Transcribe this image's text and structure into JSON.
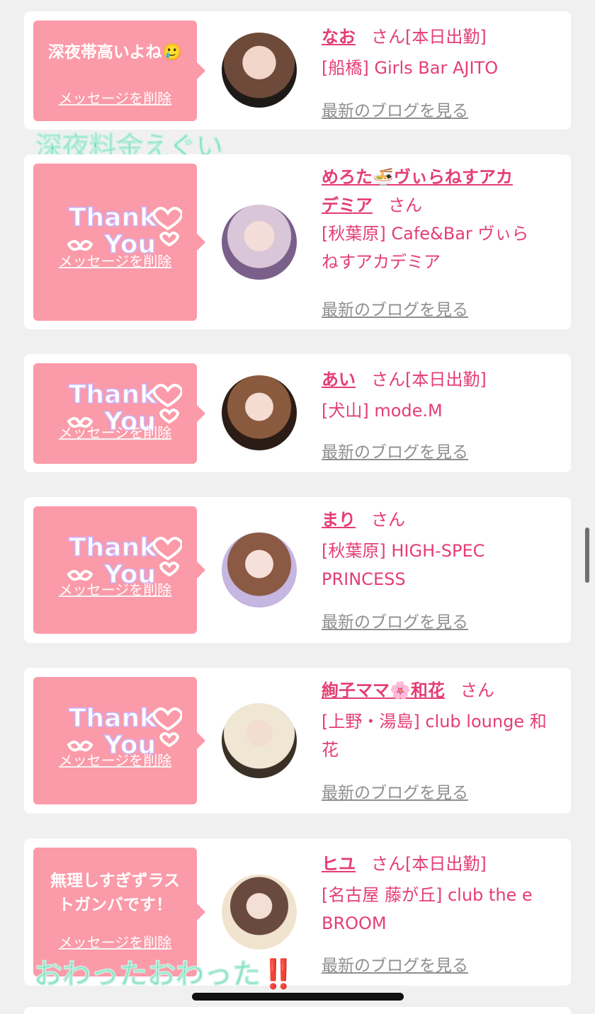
{
  "cards": [
    {
      "message": "深夜帯高いよね🥲",
      "delete_label": "メッセージを削除",
      "name": "なお",
      "san": "さん",
      "status": "[本日出勤]",
      "shop_line1": "[船橋] Girls Bar AJITO",
      "shop_line2": "",
      "blog_label": "最新のブログを見る"
    },
    {
      "message": "",
      "sticker": "Thank You",
      "delete_label": "メッセージを削除",
      "name_line1": "めろた🍜ヴぃらねすアカ",
      "name_line2": "デミア",
      "san": "さん",
      "shop_line1": "[秋葉原] Cafe&Bar ヴぃら",
      "shop_line2": "ねすアカデミア",
      "blog_label": "最新のブログを見る"
    },
    {
      "sticker": "Thank You",
      "delete_label": "メッセージを削除",
      "name": "あい",
      "san": "さん",
      "status": "[本日出勤]",
      "shop_line1": "[犬山] mode.M",
      "blog_label": "最新のブログを見る"
    },
    {
      "sticker": "Thank You",
      "delete_label": "メッセージを削除",
      "name": "まり",
      "san": "さん",
      "shop_line1": "[秋葉原] HIGH-SPEC",
      "shop_line2": "PRINCESS",
      "blog_label": "最新のブログを見る"
    },
    {
      "sticker": "Thank You",
      "delete_label": "メッセージを削除",
      "name": "絢子ママ🌸和花",
      "san": "さん",
      "shop_line1": "[上野・湯島] club lounge 和",
      "shop_line2": "花",
      "blog_label": "最新のブログを見る"
    },
    {
      "message_line1": "無理しすぎずラス",
      "message_line2": "トガンバです！",
      "delete_label": "メッセージを削除",
      "name": "ヒユ",
      "san": "さん",
      "status": "[本日出勤]",
      "shop_line1": "[名古屋 藤が丘] club the e",
      "shop_line2": "BROOM",
      "blog_label": "最新のブログを見る"
    }
  ],
  "overlays": {
    "top_caption": "深夜料金えぐい",
    "bottom_caption": "おわったおわった‼️"
  },
  "colors": {
    "accent_pink": "#e43e73",
    "bubble_pink": "#fb9aa8",
    "caption_green": "#4cd9a6",
    "link_gray": "#8f8f8f",
    "background": "#f0f0f0"
  }
}
